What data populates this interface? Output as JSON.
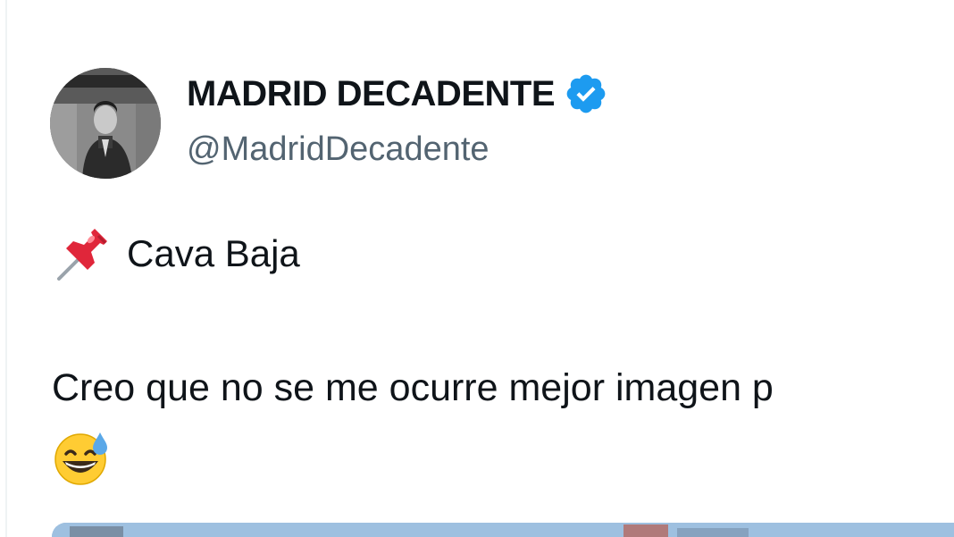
{
  "tweet": {
    "display_name": "MADRID DECADENTE",
    "handle": "@MadridDecadente",
    "pinned_location": "Cava Baja",
    "body": "Creo que no se me ocurre mejor imagen p",
    "icons": {
      "avatar": "avatar-photo",
      "verified": "verified-badge-icon",
      "pin": "pushpin-icon",
      "emoji": "grinning-face-with-sweat-icon"
    },
    "colors": {
      "verified_blue": "#1d9bf0",
      "handle_gray": "#536471",
      "text": "#0f1419"
    }
  }
}
